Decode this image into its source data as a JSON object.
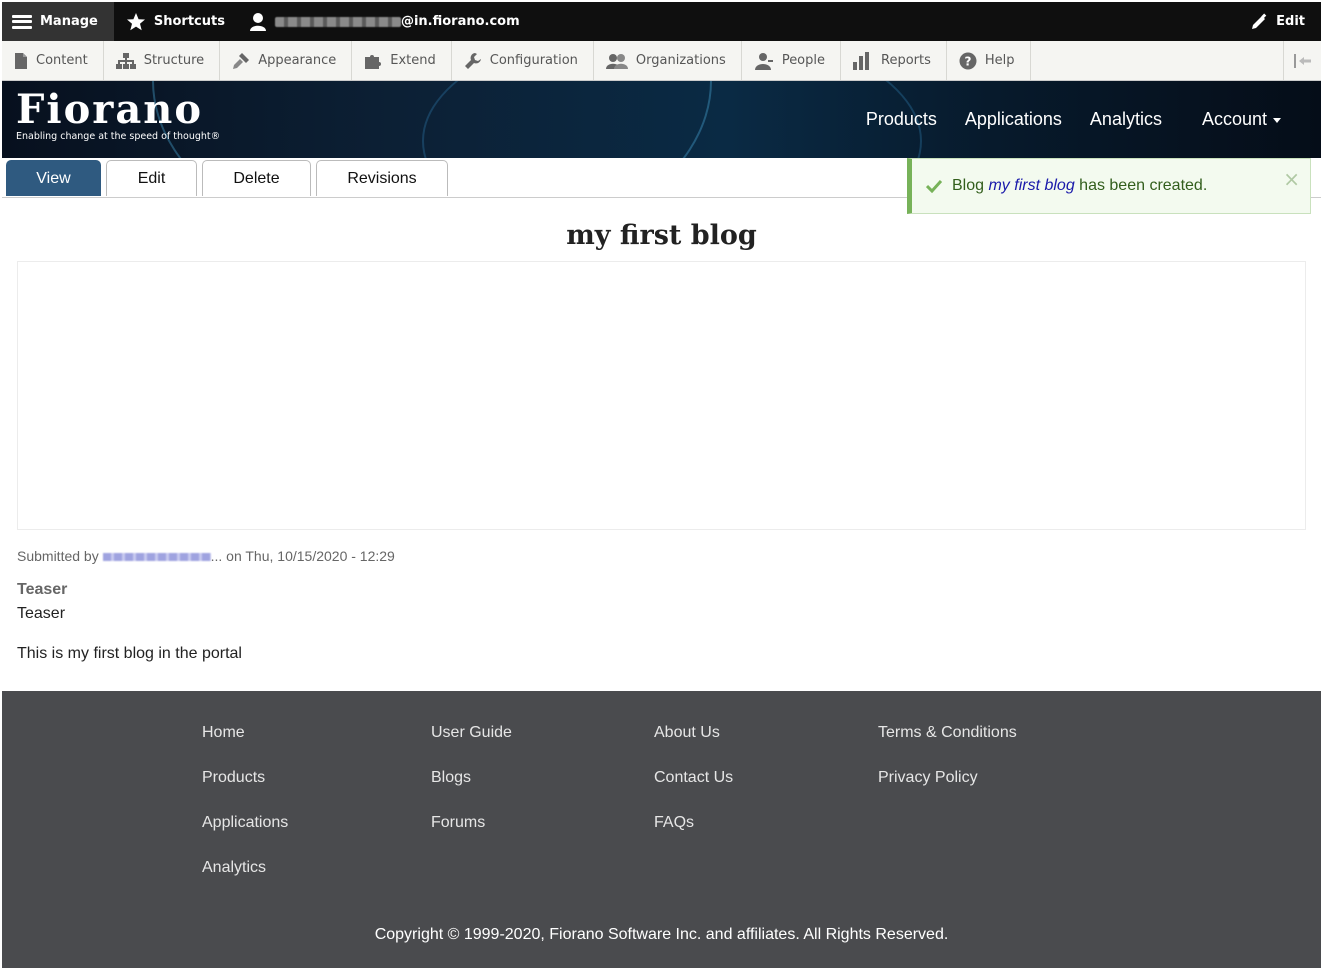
{
  "toolbar": {
    "manage": "Manage",
    "shortcuts": "Shortcuts",
    "user_email_suffix": "@in.fiorano.com",
    "edit": "Edit"
  },
  "tray": {
    "items": [
      "Content",
      "Structure",
      "Appearance",
      "Extend",
      "Configuration",
      "Organizations",
      "People",
      "Reports",
      "Help"
    ]
  },
  "header": {
    "logo": "Fiorano",
    "tagline": "Enabling change at the speed of thought®",
    "nav": [
      "Products",
      "Applications",
      "Analytics",
      "Account"
    ]
  },
  "tabs": [
    "View",
    "Edit",
    "Delete",
    "Revisions"
  ],
  "status": {
    "prefix": "Blog ",
    "link": "my first blog",
    "suffix": " has been created.",
    "close": "×"
  },
  "article": {
    "title": "my first blog",
    "submitted_prefix": "Submitted by ",
    "submitted_suffix": "... on Thu, 10/15/2020 - 12:29",
    "teaser_label": "Teaser",
    "teaser_value": "Teaser",
    "body": "This is my first blog in the portal"
  },
  "footer": {
    "col1": [
      "Home",
      "Products",
      "Applications",
      "Analytics"
    ],
    "col2": [
      "User Guide",
      "Blogs",
      "Forums"
    ],
    "col3": [
      "About Us",
      "Contact Us",
      "FAQs"
    ],
    "col4": [
      "Terms & Conditions",
      "Privacy Policy"
    ],
    "copyright": "Copyright © 1999-2020, Fiorano Software Inc. and affiliates. All Rights Reserved."
  }
}
